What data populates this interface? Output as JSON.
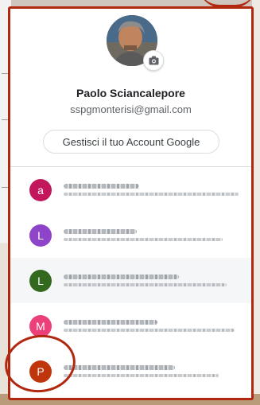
{
  "profile": {
    "name": "Paolo Sciancalepore",
    "email": "sspgmonterisi@gmail.com",
    "manage_button": "Gestisci il tuo Account Google",
    "avatar_badge_icon": "camera-icon"
  },
  "accounts": [
    {
      "initial": "a",
      "color": "#c2185b"
    },
    {
      "initial": "L",
      "color": "#8e44c9"
    },
    {
      "initial": "L",
      "color": "#33691e"
    },
    {
      "initial": "M",
      "color": "#ec407a"
    },
    {
      "initial": "P",
      "color": "#bf360c"
    }
  ],
  "colors": {
    "annotation": "#b1270f"
  }
}
